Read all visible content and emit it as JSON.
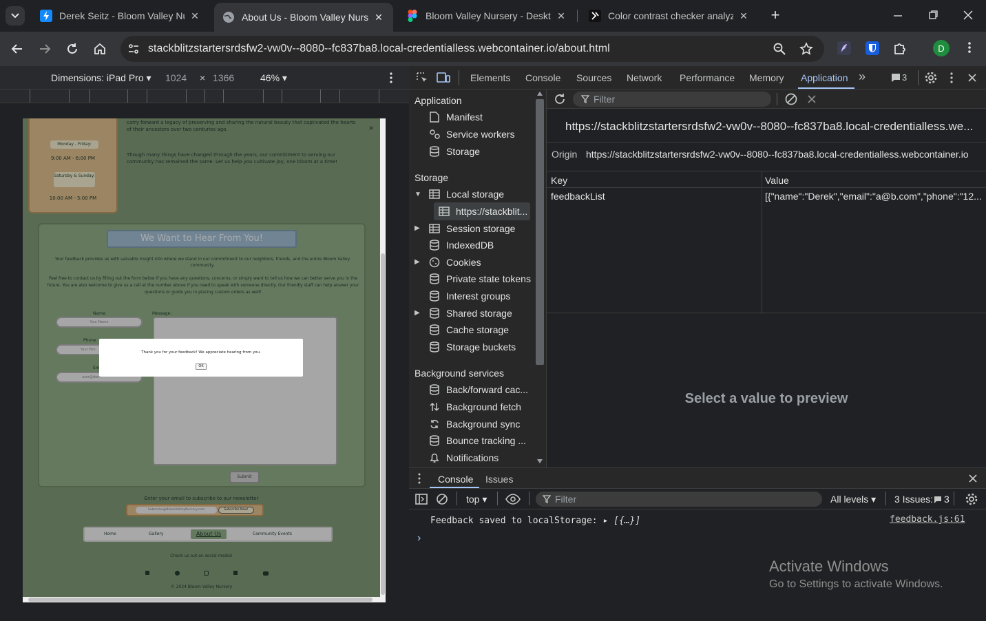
{
  "tabs": [
    {
      "title": "Derek Seitz - Bloom Valley Nurs",
      "active": false
    },
    {
      "title": "About Us - Bloom Valley Nurser",
      "active": true
    },
    {
      "title": "Bloom Valley Nursery - Desktop",
      "active": false
    },
    {
      "title": "Color contrast checker analyzer",
      "active": false
    }
  ],
  "browser": {
    "url": "stackblitzstartersrdsfw2-vw0v--8080--fc837ba8.local-credentialless.webcontainer.io/about.html",
    "profile_initial": "D"
  },
  "device_bar": {
    "dimensions_label": "Dimensions: iPad Pro ▾",
    "width": "1024",
    "times": "×",
    "height": "1366",
    "zoom": "46% ▾"
  },
  "page": {
    "intro1": "carry forward a legacy of preserving and sharing the natural beauty that captivated the hearts of their ancestors over two centuries ago.",
    "intro2": "Though many things have changed through the years, our commitment to serving our community has remained the same. Let us help you cultivate joy, one bloom at a time!",
    "hours": [
      {
        "day": "Monday - Friday:",
        "time": "9:00 AM - 6:00 PM"
      },
      {
        "day": "Saturday & Sunday:",
        "time": "10:00 AM - 5:00 PM"
      }
    ],
    "feedback_heading": "We Want to Hear From You!",
    "feedback_p1": "Your feedback provides us with valuable insight into where we stand in our commitment to our neighbors, friends, and the entire Bloom Valley community.",
    "feedback_p2": "Feel free to contact us by filling out the form below if you have any questions, concerns, or simply want to tell us how we can better serve you in the future. You are also welcome to give us a call at the number above if you need to speak with someone directly. Our friendly staff can help answer your questions or guide you in placing custom orders as well!",
    "name_label": "Name:",
    "name_placeholder": "Your Name",
    "phone_label": "Phone",
    "phone_placeholder": "Your Pho",
    "email_label": "Em",
    "email_placeholder": "user@dom",
    "message_label": "Message:",
    "submit": "Submit",
    "newsletter_label": "Enter your email to subscribe to our newsletter",
    "newsletter_placeholder": "Subscribe@BloomValleyNursery.com",
    "subscribe": "Subscribe Now!",
    "nav": [
      "Home",
      "Gallery",
      "About Us",
      "Community Events"
    ],
    "social_text": "Check us out on social media!",
    "copyright": "© 2024 Bloom Valley Nursery",
    "close_x": "×",
    "dialog_msg": "Thank you for your feedback! We appreciate hearing from you.",
    "dialog_ok": "OK"
  },
  "devtools": {
    "tabs": [
      "Elements",
      "Console",
      "Sources",
      "Network",
      "Performance",
      "Memory",
      "Application"
    ],
    "more": "»",
    "issues_count": "3",
    "sidebar": {
      "application_header": "Application",
      "application_items": [
        "Manifest",
        "Service workers",
        "Storage"
      ],
      "storage_header": "Storage",
      "storage_items": [
        "Local storage",
        "https://stackblit...",
        "Session storage",
        "IndexedDB",
        "Cookies",
        "Private state tokens",
        "Interest groups",
        "Shared storage",
        "Cache storage",
        "Storage buckets"
      ],
      "bg_header": "Background services",
      "bg_items": [
        "Back/forward cac...",
        "Background fetch",
        "Background sync",
        "Bounce tracking ...",
        "Notifications"
      ]
    },
    "filter_placeholder": "Filter",
    "storage_title": "https://stackblitzstartersrdsfw2-vw0v--8080--fc837ba8.local-credentialless.we...",
    "origin_label": "Origin",
    "origin_value": "https://stackblitzstartersrdsfw2-vw0v--8080--fc837ba8.local-credentialless.webcontainer.io",
    "col_key": "Key",
    "col_value": "Value",
    "row_key": "feedbackList",
    "row_value": "[{\"name\":\"Derek\",\"email\":\"a@b.com\",\"phone\":\"12...",
    "preview_placeholder": "Select a value to preview"
  },
  "console": {
    "tabs": [
      "Console",
      "Issues"
    ],
    "context": "top ▾",
    "filter_placeholder": "Filter",
    "levels": "All levels ▾",
    "issues": "3 Issues:",
    "issues_count": "3",
    "log_text": "Feedback saved to localStorage:",
    "log_obj": "▸ [{…}]",
    "log_src": "feedback.js:61",
    "prompt": "›"
  },
  "watermark": {
    "title": "Activate Windows",
    "subtitle": "Go to Settings to activate Windows."
  },
  "colors": {
    "accent_blue": "#a8c7fa",
    "page_green": "#7d9575",
    "page_tan": "#d9b98a"
  }
}
